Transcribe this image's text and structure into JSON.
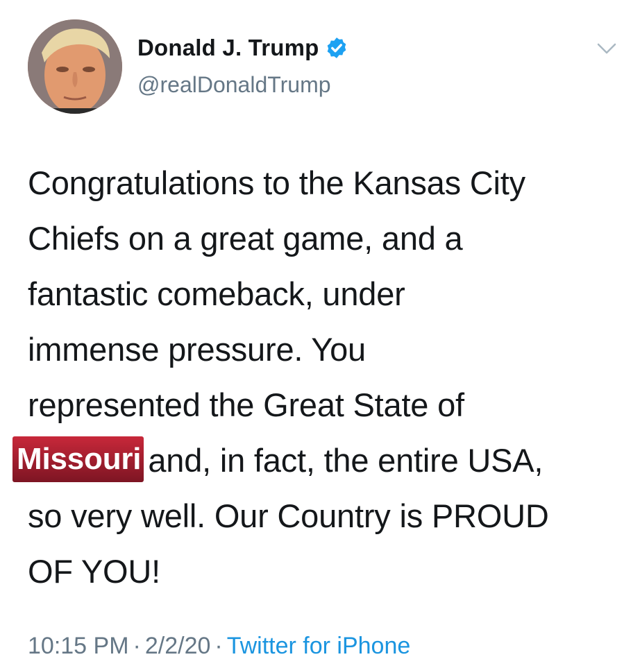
{
  "author": {
    "display_name": "Donald J. Trump",
    "handle": "@realDonaldTrump",
    "verified": true,
    "avatar_icon": "profile-photo"
  },
  "tweet": {
    "lines": [
      "Congratulations to the Kansas City",
      "Chiefs on a great game, and a",
      "fantastic comeback, under",
      "immense pressure. You",
      "represented the Great State of"
    ],
    "highlight": "Missouri",
    "line6_rest": "and, in fact, the entire USA,",
    "line7": "so very well. Our Country is PROUD",
    "line8": "OF YOU!"
  },
  "meta": {
    "time": "10:15 PM",
    "date": "2/2/20",
    "separator": "·",
    "source": "Twitter for iPhone"
  },
  "colors": {
    "text": "#14171a",
    "secondary": "#657786",
    "link": "#1b95e0",
    "verified": "#1da1f2",
    "highlight_top": "#c8283a",
    "highlight_bottom": "#7d1523"
  }
}
